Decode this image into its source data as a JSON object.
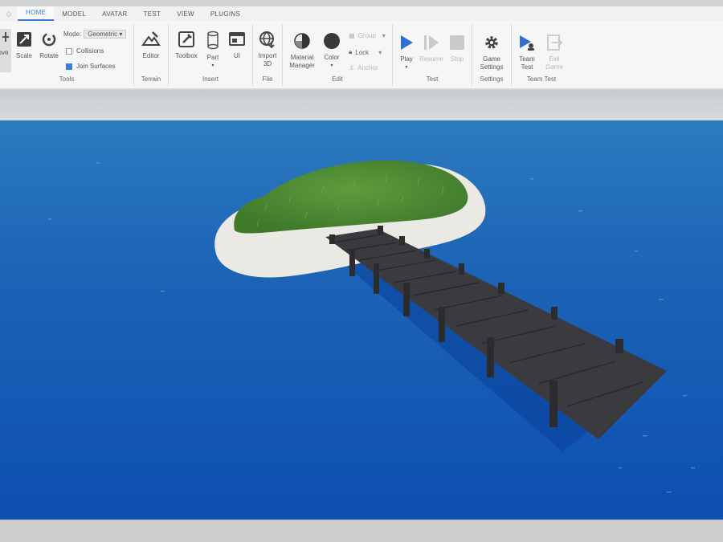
{
  "menu": {
    "logo": "◇",
    "tabs": [
      "HOME",
      "MODEL",
      "AVATAR",
      "TEST",
      "VIEW",
      "PLUGINS"
    ]
  },
  "tools": {
    "move_label": "ove",
    "scale_label": "Scale",
    "rotate_label": "Rotate",
    "mode_label": "Mode:",
    "mode_value": "Geometric",
    "collisions_label": "Collisions",
    "join_surfaces_label": "Join Surfaces",
    "group_label": "Tools"
  },
  "terrain": {
    "editor_label": "Editor",
    "group_label": "Terrain"
  },
  "insert": {
    "toolbox_label": "Toolbox",
    "part_label": "Part",
    "ui_label": "UI",
    "group_label": "Insert"
  },
  "file": {
    "import_label_1": "Import",
    "import_label_2": "3D",
    "group_label": "File"
  },
  "edit": {
    "material_label_1": "Material",
    "material_label_2": "Manager",
    "color_label": "Color",
    "group_btn": "Group",
    "lock_btn": "Lock",
    "anchor_btn": "Anchor",
    "group_label": "Edit"
  },
  "test": {
    "play_label": "Play",
    "resume_label": "Resume",
    "stop_label": "Stop",
    "group_label": "Test"
  },
  "settings": {
    "game_label_1": "Game",
    "game_label_2": "Settings",
    "group_label": "Settings"
  },
  "team_test": {
    "team_label_1": "Team",
    "team_label_2": "Test",
    "exit_label_1": "Exit",
    "exit_label_2": "Game",
    "group_label": "Team Test"
  },
  "colors": {
    "accent": "#3b7dd8",
    "water": "#1b5fb2",
    "sand": "#e9e6df",
    "grass": "#4e8a34",
    "dock": "#3a3a3d"
  }
}
